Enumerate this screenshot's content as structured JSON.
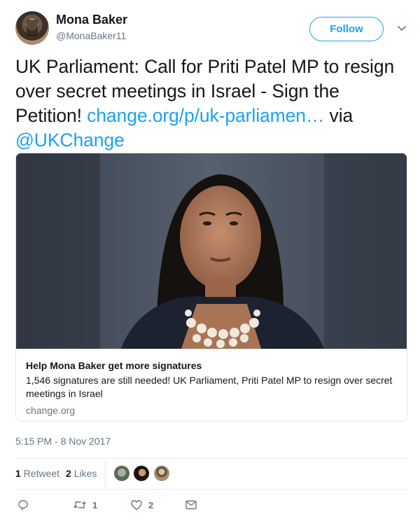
{
  "user": {
    "name": "Mona Baker",
    "handle": "@MonaBaker11",
    "follow_label": "Follow"
  },
  "tweet": {
    "text_before": "UK Parliament: Call for Priti Patel MP to resign over secret meetings in Israel - Sign the Petition! ",
    "link": "change.org/p/uk-parliamen…",
    "text_mid": " via ",
    "mention": "@UKChange"
  },
  "card": {
    "title": "Help Mona Baker get more signatures",
    "description": "1,546 signatures are still needed! UK Parliament, Priti Patel MP to resign over secret meetings in Israel",
    "domain": "change.org"
  },
  "timestamp": "5:15 PM - 8 Nov 2017",
  "stats": {
    "retweets_count": "1",
    "retweets_label": "Retweet",
    "likes_count": "2",
    "likes_label": "Likes"
  },
  "actions": {
    "retweet_count": "1",
    "like_count": "2"
  },
  "icons": [
    "chevron-down-icon",
    "reply-icon",
    "retweet-icon",
    "heart-icon",
    "mail-icon"
  ],
  "colors": {
    "accent": "#1da1f2",
    "text": "#14171a",
    "muted": "#657786",
    "border": "#e1e8ed"
  }
}
